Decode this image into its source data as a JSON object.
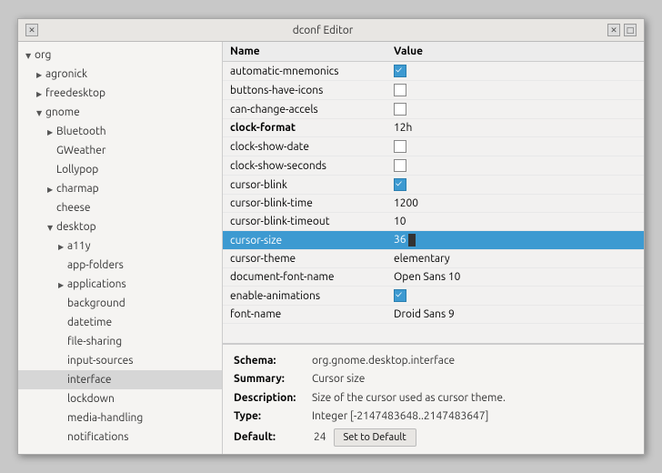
{
  "window": {
    "title": "dconf Editor"
  },
  "titlebar": {
    "close_label": "✕",
    "maximize_label": "□"
  },
  "sidebar": {
    "items": [
      {
        "id": "org",
        "label": "org",
        "indent": 1,
        "arrow": "open",
        "selected": false
      },
      {
        "id": "agronick",
        "label": "agronick",
        "indent": 2,
        "arrow": "closed",
        "selected": false
      },
      {
        "id": "freedesktop",
        "label": "freedesktop",
        "indent": 2,
        "arrow": "closed",
        "selected": false
      },
      {
        "id": "gnome",
        "label": "gnome",
        "indent": 2,
        "arrow": "open",
        "selected": false
      },
      {
        "id": "Bluetooth",
        "label": "Bluetooth",
        "indent": 3,
        "arrow": "closed",
        "selected": false
      },
      {
        "id": "GWeather",
        "label": "GWeather",
        "indent": 3,
        "arrow": "none",
        "selected": false
      },
      {
        "id": "Lollypop",
        "label": "Lollypop",
        "indent": 3,
        "arrow": "none",
        "selected": false
      },
      {
        "id": "charmap",
        "label": "charmap",
        "indent": 3,
        "arrow": "closed",
        "selected": false
      },
      {
        "id": "cheese",
        "label": "cheese",
        "indent": 3,
        "arrow": "none",
        "selected": false
      },
      {
        "id": "desktop",
        "label": "desktop",
        "indent": 3,
        "arrow": "open",
        "selected": false
      },
      {
        "id": "a11y",
        "label": "a11y",
        "indent": 4,
        "arrow": "closed",
        "selected": false
      },
      {
        "id": "app-folders",
        "label": "app-folders",
        "indent": 4,
        "arrow": "none",
        "selected": false
      },
      {
        "id": "applications",
        "label": "applications",
        "indent": 4,
        "arrow": "closed",
        "selected": false
      },
      {
        "id": "background",
        "label": "background",
        "indent": 4,
        "arrow": "none",
        "selected": false
      },
      {
        "id": "datetime",
        "label": "datetime",
        "indent": 4,
        "arrow": "none",
        "selected": false
      },
      {
        "id": "file-sharing",
        "label": "file-sharing",
        "indent": 4,
        "arrow": "none",
        "selected": false
      },
      {
        "id": "input-sources",
        "label": "input-sources",
        "indent": 4,
        "arrow": "none",
        "selected": false
      },
      {
        "id": "interface",
        "label": "interface",
        "indent": 4,
        "arrow": "none",
        "selected": true
      },
      {
        "id": "lockdown",
        "label": "lockdown",
        "indent": 4,
        "arrow": "none",
        "selected": false
      },
      {
        "id": "media-handling",
        "label": "media-handling",
        "indent": 4,
        "arrow": "none",
        "selected": false
      },
      {
        "id": "notifications",
        "label": "notifications",
        "indent": 4,
        "arrow": "none",
        "selected": false
      }
    ]
  },
  "table": {
    "columns": [
      "Name",
      "Value"
    ],
    "rows": [
      {
        "name": "automatic-mnemonics",
        "value_type": "checkbox",
        "checked": true,
        "bold": false
      },
      {
        "name": "buttons-have-icons",
        "value_type": "checkbox",
        "checked": false,
        "bold": false
      },
      {
        "name": "can-change-accels",
        "value_type": "checkbox",
        "checked": false,
        "bold": false
      },
      {
        "name": "clock-format",
        "value_type": "text",
        "value": "12h",
        "bold": true
      },
      {
        "name": "clock-show-date",
        "value_type": "checkbox",
        "checked": false,
        "bold": false
      },
      {
        "name": "clock-show-seconds",
        "value_type": "checkbox",
        "checked": false,
        "bold": false
      },
      {
        "name": "cursor-blink",
        "value_type": "checkbox",
        "checked": true,
        "bold": false
      },
      {
        "name": "cursor-blink-time",
        "value_type": "text",
        "value": "1200",
        "bold": false
      },
      {
        "name": "cursor-blink-timeout",
        "value_type": "text",
        "value": "10",
        "bold": false
      },
      {
        "name": "cursor-size",
        "value_type": "text",
        "value": "36",
        "bold": false,
        "selected": true
      },
      {
        "name": "cursor-theme",
        "value_type": "text",
        "value": "elementary",
        "bold": false
      },
      {
        "name": "document-font-name",
        "value_type": "text",
        "value": "Open Sans 10",
        "bold": false
      },
      {
        "name": "enable-animations",
        "value_type": "checkbox",
        "checked": true,
        "bold": false
      },
      {
        "name": "font-name",
        "value_type": "text",
        "value": "Droid Sans 9",
        "bold": false
      }
    ]
  },
  "info": {
    "schema_label": "Schema:",
    "schema_value": "org.gnome.desktop.interface",
    "summary_label": "Summary:",
    "summary_value": "Cursor size",
    "description_label": "Description:",
    "description_value": "Size of the cursor used as cursor theme.",
    "type_label": "Type:",
    "type_value": "Integer [-2147483648..2147483647]",
    "default_label": "Default:",
    "default_value": "24",
    "set_default_btn": "Set to Default"
  }
}
